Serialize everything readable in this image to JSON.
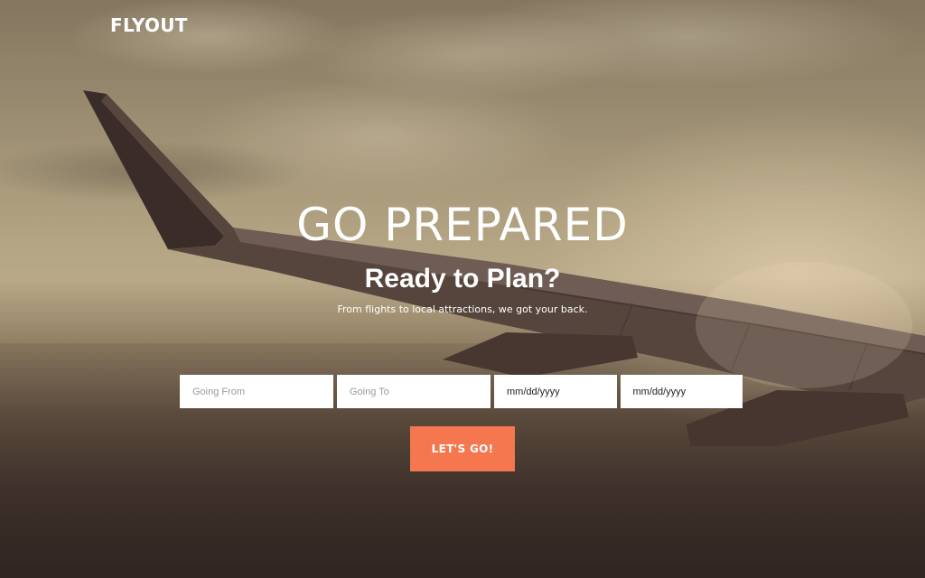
{
  "brand": {
    "logo_text": "FLYOUT"
  },
  "hero": {
    "headline": "GO PREPARED",
    "subheadline": "Ready to Plan?",
    "tagline": "From flights to local attractions, we got your back."
  },
  "search_form": {
    "origin_placeholder": "Going From",
    "destination_placeholder": "Going To",
    "depart_date_value": "mm/dd/yyyy",
    "return_date_value": "mm/dd/yyyy",
    "submit_label": "LET'S GO!"
  },
  "colors": {
    "accent": "#f4774f",
    "text_on_image": "#ffffff",
    "input_background": "#ffffff"
  },
  "background": {
    "icon": "airplane-wing-photo"
  }
}
